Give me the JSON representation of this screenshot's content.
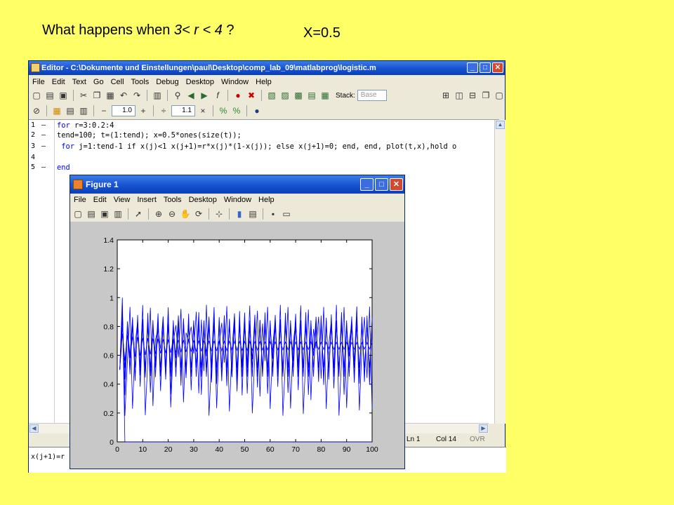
{
  "slide": {
    "title_pre": "What happens when ",
    "title_math": "3< r < 4",
    "title_post": " ?",
    "x_value": "X=0.5"
  },
  "editor": {
    "title": "Editor - C:\\Dokumente und Einstellungen\\paul\\Desktop\\comp_lab_09\\matlabprog\\logistic.m",
    "menu": [
      "File",
      "Edit",
      "Text",
      "Go",
      "Cell",
      "Tools",
      "Debug",
      "Desktop",
      "Window",
      "Help"
    ],
    "stack_label": "Stack:",
    "stack_value": "Base",
    "cell_value_a": "1.0",
    "cell_value_b": "1.1",
    "lines": [
      {
        "num": "1",
        "dash": "–",
        "pre": "",
        "kw": "for",
        "rest": " r=3:0.2:4"
      },
      {
        "num": "2",
        "dash": "–",
        "pre": "",
        "kw": "",
        "rest": "tend=100; t=(1:tend); x=0.5*ones(size(t));"
      },
      {
        "num": "3",
        "dash": "–",
        "pre": " ",
        "kw": "for",
        "rest": " j=1:tend-1 if x(j)<1 x(j+1)=r*x(j)*(1-x(j)); else x(j+1)=0; end, end, plot(t,x),hold o"
      },
      {
        "num": "4",
        "dash": "",
        "pre": "",
        "kw": "",
        "rest": ""
      },
      {
        "num": "5",
        "dash": "–",
        "pre": "",
        "kw": "end",
        "rest": ""
      }
    ],
    "status_ln": "Ln  1",
    "status_col": "Col  14",
    "status_ovr": "OVR",
    "cmd_text": "x(j+1)=r"
  },
  "figure": {
    "title": "Figure 1",
    "menu": [
      "File",
      "Edit",
      "View",
      "Insert",
      "Tools",
      "Desktop",
      "Window",
      "Help"
    ]
  },
  "chart_data": {
    "type": "line",
    "title": "",
    "xlabel": "",
    "ylabel": "",
    "xlim": [
      0,
      100
    ],
    "ylim": [
      0,
      1.4
    ],
    "xticks": [
      "0",
      "10",
      "20",
      "30",
      "40",
      "50",
      "60",
      "70",
      "80",
      "90",
      "100"
    ],
    "yticks": [
      "0",
      "0.2",
      "0.4",
      "0.6",
      "0.8",
      "1",
      "1.2",
      "1.4"
    ],
    "x_start": 0.5,
    "r_values": [
      3.0,
      3.2,
      3.4,
      3.6,
      3.8,
      4.0
    ],
    "n_points": 100,
    "color": "#0000ff",
    "grid": false
  }
}
